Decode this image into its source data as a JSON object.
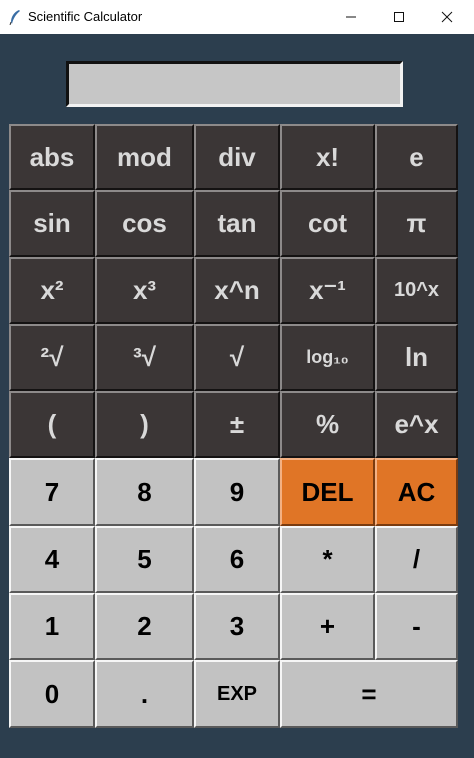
{
  "window": {
    "title": "Scientific Calculator",
    "icon": "feather-icon"
  },
  "display": {
    "value": ""
  },
  "keypad": {
    "abs": "abs",
    "mod": "mod",
    "div": "div",
    "fact": "x!",
    "e": "e",
    "sin": "sin",
    "cos": "cos",
    "tan": "tan",
    "cot": "cot",
    "pi": "π",
    "sq": "x²",
    "cube": "x³",
    "pow": "x^n",
    "inv": "x⁻¹",
    "tenpow": "10^x",
    "sqrt2": "²√",
    "cbrt": "³√",
    "sqrt": "√",
    "log": "log₁₀",
    "ln": "ln",
    "lparen": "(",
    "rparen": ")",
    "plusminus": "±",
    "percent": "%",
    "exp_x": "e^x",
    "seven": "7",
    "eight": "8",
    "nine": "9",
    "del": "DEL",
    "ac": "AC",
    "four": "4",
    "five": "5",
    "six": "6",
    "mul": "*",
    "divide": "/",
    "one": "1",
    "two": "2",
    "three": "3",
    "plus": "+",
    "minus": "-",
    "zero": "0",
    "dot": ".",
    "exp": "EXP",
    "equals": "="
  },
  "colors": {
    "background": "#2c3e4e",
    "sci_button": "#3b3636",
    "num_button": "#c2c2c2",
    "accent_orange": "#e07526"
  }
}
